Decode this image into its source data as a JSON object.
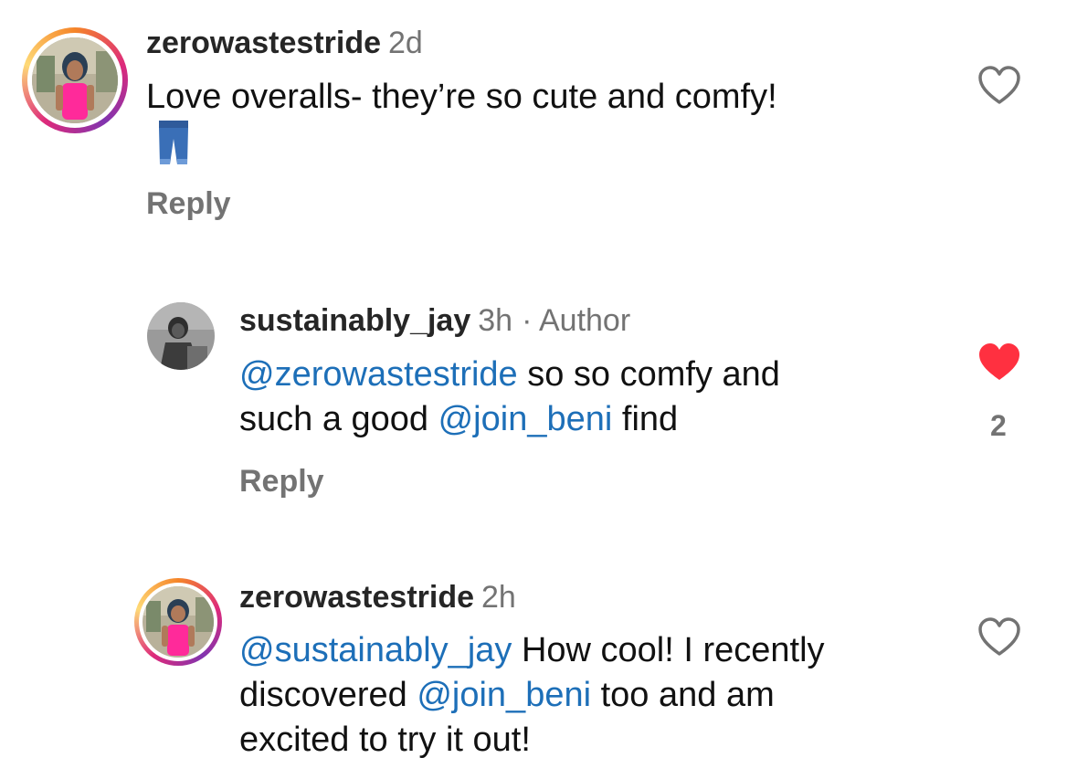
{
  "comments": [
    {
      "username": "zerowastestride",
      "time": "2d",
      "text": "Love overalls- they’re so cute and comfy!",
      "emoji": "jeans-emoji",
      "reply_label": "Reply",
      "liked": false
    },
    {
      "username": "sustainably_jay",
      "time": "3h",
      "separator": "·",
      "badge": "Author",
      "mention1": "@zerowastestride",
      "text1": " so so comfy and",
      "text2a": "such a good ",
      "mention2": "@join_beni",
      "text2b": " find",
      "reply_label": "Reply",
      "liked": true,
      "like_count": "2"
    },
    {
      "username": "zerowastestride",
      "time": "2h",
      "mention1": "@sustainably_jay",
      "text1": " How cool! I recently",
      "text2a": "discovered ",
      "mention2": "@join_beni",
      "text2b": " too and am",
      "text3": "excited to try it out!",
      "liked": false
    }
  ],
  "colors": {
    "mention": "#1d6fb8",
    "like_red": "#ff3040",
    "muted": "#737373"
  }
}
